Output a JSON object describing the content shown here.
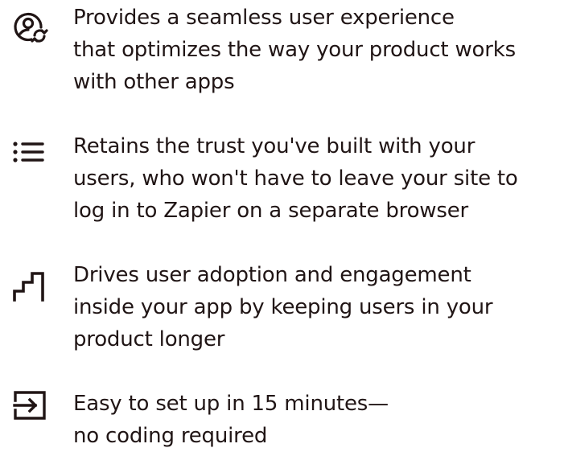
{
  "colors": {
    "text": "#201515",
    "background": "#ffffff"
  },
  "features": [
    {
      "icon": "user-sync-icon",
      "lines": [
        "Provides a seamless user experience",
        "that optimizes the way your product works",
        "with other apps"
      ]
    },
    {
      "icon": "list-icon",
      "lines": [
        "Retains the trust you've built with your",
        "users, who won't have to leave your site to",
        "log in to Zapier on a separate browser"
      ]
    },
    {
      "icon": "steps-icon",
      "lines": [
        "Drives user adoption and engagement",
        "inside your app by keeping users in your",
        "product longer"
      ]
    },
    {
      "icon": "enter-arrow-icon",
      "lines": [
        "Easy to set up in 15 minutes—",
        "no coding required"
      ]
    }
  ]
}
